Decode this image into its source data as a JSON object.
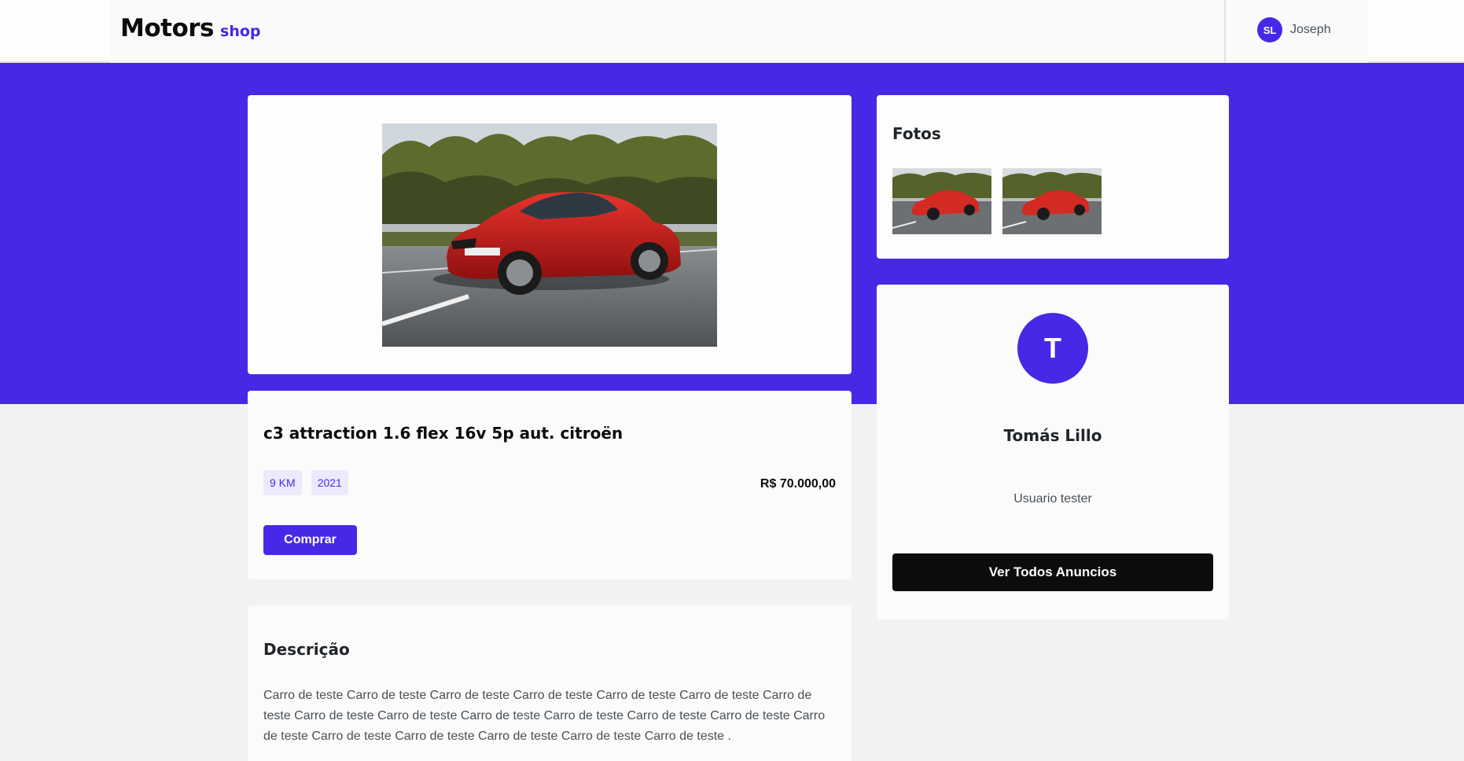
{
  "header": {
    "logo_main": "Motors",
    "logo_sub": "shop",
    "user": {
      "initials": "SL",
      "name": "Joseph"
    }
  },
  "product": {
    "title": "c3 attraction 1.6 flex 16v 5p aut. citroën",
    "tags": [
      "9 KM",
      "2021"
    ],
    "price": "R$ 70.000,00",
    "buy_label": "Comprar",
    "main_photo_icon": "red-sports-car-photo"
  },
  "description": {
    "title": "Descrição",
    "text": "Carro de teste Carro de teste Carro de teste Carro de teste Carro de teste Carro de teste Carro de teste Carro de teste Carro de teste Carro de teste Carro de teste Carro de teste Carro de teste Carro de teste Carro de teste Carro de teste Carro de teste Carro de teste Carro de teste ."
  },
  "photos": {
    "title": "Fotos",
    "count": 2
  },
  "seller": {
    "initial": "T",
    "name": "Tomás Lillo",
    "description": "Usuario tester",
    "button_label": "Ver Todos Anuncios"
  },
  "colors": {
    "brand": "#4529e6",
    "dark": "#0b0d0d",
    "tag_bg": "#edeafd",
    "page_bg": "#f1f2f4"
  }
}
